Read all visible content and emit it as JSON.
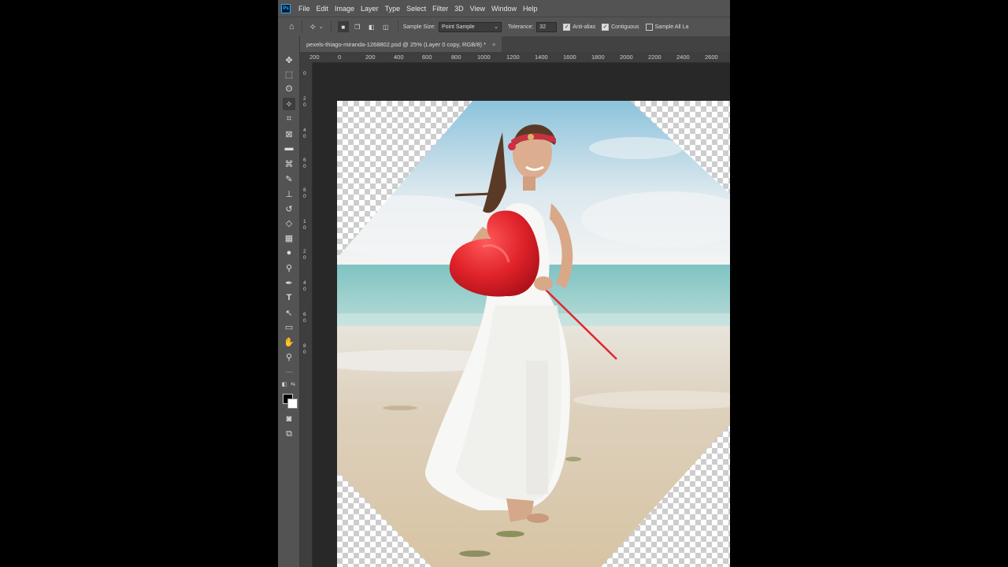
{
  "menu": {
    "app_icon": "Ps",
    "items": [
      "File",
      "Edit",
      "Image",
      "Layer",
      "Type",
      "Select",
      "Filter",
      "3D",
      "View",
      "Window",
      "Help"
    ]
  },
  "options_bar": {
    "sample_size_label": "Sample Size:",
    "sample_size_value": "Point Sample",
    "tolerance_label": "Tolerance:",
    "tolerance_value": "32",
    "anti_alias_label": "Anti-alias",
    "anti_alias_checked": true,
    "contiguous_label": "Contiguous",
    "contiguous_checked": true,
    "sample_all_label": "Sample All La",
    "sample_all_checked": false
  },
  "document": {
    "tab_title": "pexels-thiago-miranda-1268802.psd @ 25% (Layer 0 copy, RGB/8) *",
    "close_glyph": "×"
  },
  "ruler": {
    "top_labels": [
      "200",
      "0",
      "200",
      "400",
      "600",
      "800",
      "1000",
      "1200",
      "1400",
      "1600",
      "1800",
      "2000",
      "2200",
      "2400",
      "2600"
    ],
    "left_labels": [
      "0",
      "2",
      "0",
      "4",
      "0",
      "6",
      "0",
      "8",
      "0",
      "1",
      "0",
      "2",
      "0",
      "4",
      "0",
      "6",
      "0",
      "8",
      "0"
    ]
  },
  "tools": [
    {
      "name": "move-tool-icon",
      "glyph": "✥"
    },
    {
      "name": "marquee-tool-icon",
      "glyph": "⬚"
    },
    {
      "name": "lasso-tool-icon",
      "glyph": "ʘ"
    },
    {
      "name": "magic-wand-tool-icon",
      "glyph": "✧"
    },
    {
      "name": "crop-tool-icon",
      "glyph": "⌗"
    },
    {
      "name": "frame-tool-icon",
      "glyph": "⊠"
    },
    {
      "name": "ruler-tool-icon",
      "glyph": "▬"
    },
    {
      "name": "healing-brush-tool-icon",
      "glyph": "⌘"
    },
    {
      "name": "brush-tool-icon",
      "glyph": "✎"
    },
    {
      "name": "stamp-tool-icon",
      "glyph": "⊥"
    },
    {
      "name": "history-brush-tool-icon",
      "glyph": "↺"
    },
    {
      "name": "eraser-tool-icon",
      "glyph": "◇"
    },
    {
      "name": "gradient-tool-icon",
      "glyph": "▦"
    },
    {
      "name": "blur-tool-icon",
      "glyph": "●"
    },
    {
      "name": "dodge-tool-icon",
      "glyph": "⚲"
    },
    {
      "name": "pen-tool-icon",
      "glyph": "✒"
    },
    {
      "name": "type-tool-icon",
      "glyph": "T"
    },
    {
      "name": "path-selection-tool-icon",
      "glyph": "↖"
    },
    {
      "name": "rectangle-tool-icon",
      "glyph": "▭"
    },
    {
      "name": "hand-tool-icon",
      "glyph": "✋"
    },
    {
      "name": "zoom-tool-icon",
      "glyph": "⚲"
    },
    {
      "name": "more-tools-icon",
      "glyph": "···"
    }
  ],
  "colors": {
    "ui_background": "#535353",
    "canvas_background": "#282828",
    "foreground_swatch": "#000000",
    "background_swatch": "#ffffff"
  }
}
